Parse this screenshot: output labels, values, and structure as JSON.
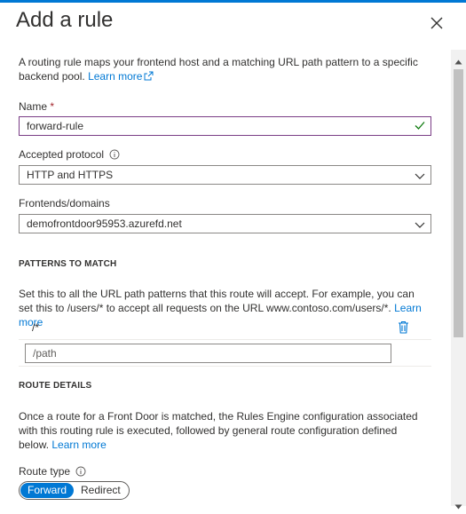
{
  "panel": {
    "title": "Add a rule",
    "intro": "A routing rule maps your frontend host and a matching URL path pattern to a specific backend pool.",
    "intro_link": "Learn more"
  },
  "name_field": {
    "label": "Name",
    "required_mark": "*",
    "value": "forward-rule"
  },
  "protocol": {
    "label": "Accepted protocol",
    "value": "HTTP and HTTPS"
  },
  "frontends": {
    "label": "Frontends/domains",
    "value": "demofrontdoor95953.azurefd.net"
  },
  "patterns": {
    "heading": "PATTERNS TO MATCH",
    "description": "Set this to all the URL path patterns that this route will accept. For example, you can set this to /users/* to accept all requests on the URL www.contoso.com/users/*.",
    "link": "Learn more",
    "items": [
      "/*"
    ],
    "new_placeholder": "/path"
  },
  "route_details": {
    "heading": "ROUTE DETAILS",
    "description": "Once a route for a Front Door is matched, the Rules Engine configuration associated with this routing rule is executed, followed by general route configuration defined below.",
    "link": "Learn more"
  },
  "route_type": {
    "label": "Route type",
    "options": [
      "Forward",
      "Redirect"
    ],
    "selected": "Forward"
  },
  "colors": {
    "accent": "#0078d4",
    "valid_check": "#107c10",
    "valid_border": "#7a3d86",
    "delete_icon": "#0078d4"
  }
}
